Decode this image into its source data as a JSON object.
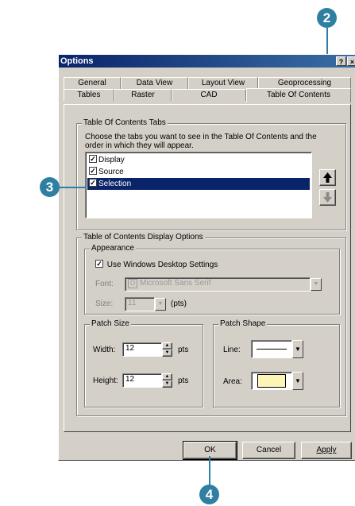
{
  "callouts": {
    "c2": "2",
    "c3": "3",
    "c4": "4"
  },
  "dialog": {
    "title": "Options",
    "help_button": "?",
    "close_button": "×",
    "tabs_row1": [
      "General",
      "Data View",
      "Layout View",
      "Geoprocessing"
    ],
    "tabs_row2": [
      "Tables",
      "Raster",
      "CAD",
      "Table Of Contents"
    ],
    "toc_tabs": {
      "legend": "Table Of Contents Tabs",
      "instructions": "Choose the tabs you want to see in the Table Of Contents and the order in which they will appear.",
      "items": [
        {
          "label": "Display",
          "checked": true,
          "selected": false
        },
        {
          "label": "Source",
          "checked": true,
          "selected": false
        },
        {
          "label": "Selection",
          "checked": true,
          "selected": true
        }
      ],
      "move_up_icon": "arrow-up-icon",
      "move_down_icon": "arrow-down-icon"
    },
    "display_options": {
      "legend": "Table of Contents Display Options",
      "appearance": {
        "legend": "Appearance",
        "use_windows_settings_label": "Use Windows Desktop Settings",
        "use_windows_settings_checked": true,
        "font_label": "Font:",
        "font_value": "Microsoft Sans Serif",
        "font_icon": "O",
        "size_label": "Size:",
        "size_value": "11",
        "size_unit": "(pts)"
      },
      "patch_size": {
        "legend": "Patch Size",
        "width_label": "Width:",
        "width_value": "12",
        "width_unit": "pts",
        "height_label": "Height:",
        "height_value": "12",
        "height_unit": "pts"
      },
      "patch_shape": {
        "legend": "Patch Shape",
        "line_label": "Line:",
        "area_label": "Area:",
        "area_fill_color": "#fdf5b6"
      }
    },
    "buttons": {
      "ok": "OK",
      "cancel": "Cancel",
      "apply": "Apply"
    }
  }
}
